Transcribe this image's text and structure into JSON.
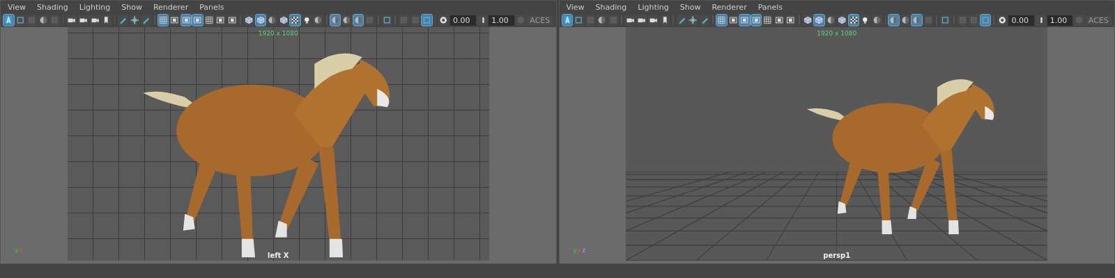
{
  "panels": [
    {
      "menu": [
        "View",
        "Shading",
        "Lighting",
        "Show",
        "Renderer",
        "Panels"
      ],
      "toolbar": [
        [
          {
            "kind": "letter",
            "selected": true
          },
          {
            "kind": "frame",
            "selected": false
          },
          {
            "kind": "square",
            "selected": false
          },
          {
            "kind": "sphere",
            "selected": false
          },
          {
            "kind": "square",
            "selected": false
          }
        ],
        [
          {
            "kind": "camera",
            "selected": false
          },
          {
            "kind": "camera",
            "selected": false
          },
          {
            "kind": "camera",
            "selected": false
          },
          {
            "kind": "bookmark",
            "selected": false
          }
        ],
        [
          {
            "kind": "pen",
            "selected": false
          },
          {
            "kind": "move",
            "selected": false
          },
          {
            "kind": "pen",
            "selected": false
          }
        ],
        [
          {
            "kind": "grid",
            "selected": true
          },
          {
            "kind": "gate",
            "selected": false
          },
          {
            "kind": "gate",
            "selected": true
          },
          {
            "kind": "gate",
            "selected": true
          },
          {
            "kind": "grid",
            "selected": false
          },
          {
            "kind": "gate",
            "selected": false
          },
          {
            "kind": "gate",
            "selected": false
          }
        ],
        [
          {
            "kind": "cube",
            "selected": false
          },
          {
            "kind": "cube",
            "selected": true
          },
          {
            "kind": "sphere",
            "selected": false
          },
          {
            "kind": "cube",
            "selected": false
          },
          {
            "kind": "checker",
            "selected": true
          },
          {
            "kind": "light",
            "selected": false
          },
          {
            "kind": "sphere",
            "selected": false
          }
        ],
        [
          {
            "kind": "sphere",
            "selected": true
          },
          {
            "kind": "sphere",
            "selected": false
          },
          {
            "kind": "sphere",
            "selected": true
          },
          {
            "kind": "square",
            "selected": false
          }
        ],
        [
          {
            "kind": "frame",
            "selected": false
          }
        ],
        [
          {
            "kind": "square",
            "selected": false
          },
          {
            "kind": "square",
            "selected": false
          },
          {
            "kind": "frame",
            "selected": true
          }
        ],
        [
          {
            "kind": "exposure",
            "selected": false
          }
        ]
      ],
      "exposure": "0.00",
      "gamma": "1.00",
      "color_space": "ACES",
      "resolution": "1920 x 1080",
      "camera": "left X",
      "kind": "ortho",
      "axis": [
        "y",
        "z"
      ]
    },
    {
      "menu": [
        "View",
        "Shading",
        "Lighting",
        "Show",
        "Renderer",
        "Panels"
      ],
      "toolbar": [
        [
          {
            "kind": "letter",
            "selected": true
          },
          {
            "kind": "frame",
            "selected": false
          },
          {
            "kind": "square",
            "selected": false
          },
          {
            "kind": "sphere",
            "selected": false
          },
          {
            "kind": "square",
            "selected": false
          }
        ],
        [
          {
            "kind": "camera",
            "selected": false
          },
          {
            "kind": "camera",
            "selected": false
          },
          {
            "kind": "camera",
            "selected": false
          },
          {
            "kind": "bookmark",
            "selected": false
          }
        ],
        [
          {
            "kind": "pen",
            "selected": false
          },
          {
            "kind": "move",
            "selected": false
          },
          {
            "kind": "pen",
            "selected": false
          }
        ],
        [
          {
            "kind": "grid",
            "selected": true
          },
          {
            "kind": "gate",
            "selected": false
          },
          {
            "kind": "gate",
            "selected": true
          },
          {
            "kind": "gate",
            "selected": true
          },
          {
            "kind": "grid",
            "selected": false
          },
          {
            "kind": "gate",
            "selected": false
          },
          {
            "kind": "gate",
            "selected": false
          }
        ],
        [
          {
            "kind": "cube",
            "selected": false
          },
          {
            "kind": "cube",
            "selected": true
          },
          {
            "kind": "sphere",
            "selected": false
          },
          {
            "kind": "cube",
            "selected": false
          },
          {
            "kind": "checker",
            "selected": true
          },
          {
            "kind": "light",
            "selected": false
          },
          {
            "kind": "sphere",
            "selected": false
          }
        ],
        [
          {
            "kind": "sphere",
            "selected": true
          },
          {
            "kind": "sphere",
            "selected": false
          },
          {
            "kind": "sphere",
            "selected": true
          },
          {
            "kind": "square",
            "selected": false
          }
        ],
        [
          {
            "kind": "frame",
            "selected": false
          }
        ],
        [
          {
            "kind": "square",
            "selected": false
          },
          {
            "kind": "square",
            "selected": false
          },
          {
            "kind": "frame",
            "selected": true
          }
        ],
        [
          {
            "kind": "exposure",
            "selected": false
          }
        ]
      ],
      "exposure": "0.00",
      "gamma": "1.00",
      "color_space": "ACES",
      "resolution": "1920 x 1080",
      "camera": "persp1",
      "kind": "perspective",
      "axis": [
        "y",
        "x",
        "z"
      ]
    }
  ]
}
